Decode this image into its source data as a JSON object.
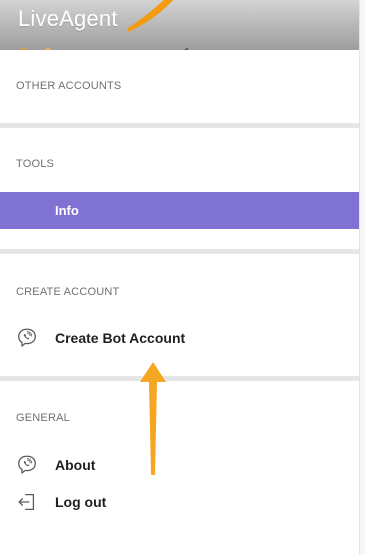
{
  "header": {
    "app_title": "LiveAgent"
  },
  "sections": {
    "other_accounts": "OTHER ACCOUNTS",
    "tools": "TOOLS",
    "create_account": "CREATE ACCOUNT",
    "general": "GENERAL"
  },
  "tools": {
    "info_label": "Info"
  },
  "create_account": {
    "create_bot_label": "Create Bot Account",
    "icon": "viber-icon"
  },
  "general": {
    "about_label": "About",
    "about_icon": "viber-icon",
    "logout_label": "Log out",
    "logout_icon": "logout-icon"
  },
  "colors": {
    "active_item": "#7f72d3",
    "arrow": "#f5a623",
    "divider": "#e6e6e6",
    "section_label": "#707070"
  }
}
